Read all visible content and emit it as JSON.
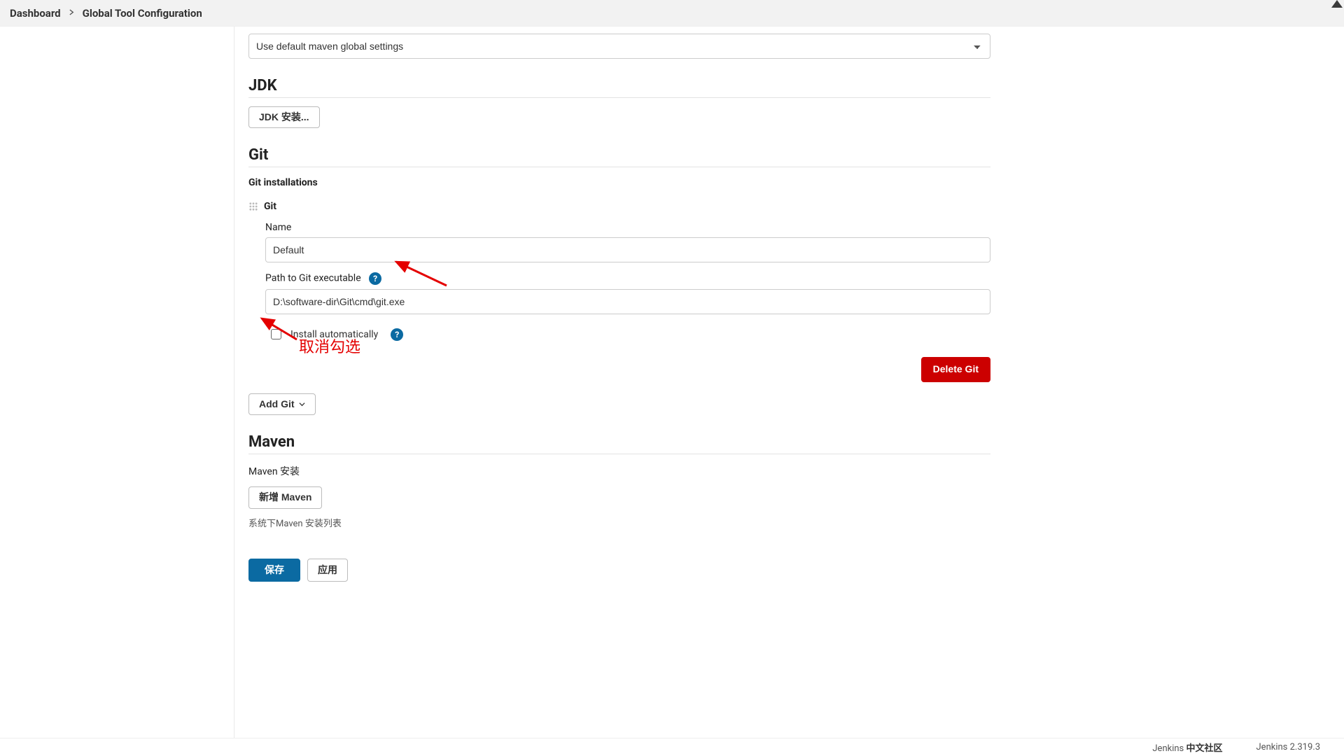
{
  "breadcrumb": {
    "dashboard": "Dashboard",
    "page": "Global Tool Configuration"
  },
  "maven_global_settings": {
    "selected": "Use default maven global settings"
  },
  "jdk": {
    "title": "JDK",
    "install_button": "JDK 安装..."
  },
  "git": {
    "title": "Git",
    "installations_label": "Git installations",
    "item_title": "Git",
    "name_label": "Name",
    "name_value": "Default",
    "path_label": "Path to Git executable",
    "path_value": "D:\\software-dir\\Git\\cmd\\git.exe",
    "install_auto_label": "Install automatically",
    "delete_button": "Delete Git",
    "add_button": "Add Git"
  },
  "maven": {
    "title": "Maven",
    "installs_label": "Maven 安装",
    "add_button": "新增 Maven",
    "hint": "系统下Maven 安装列表"
  },
  "actions": {
    "save": "保存",
    "apply": "应用"
  },
  "annotation": {
    "uncheck_text": "取消勾选"
  },
  "footer": {
    "left_prefix": "Jenkins ",
    "left_bold": "中文社区",
    "right": "Jenkins 2.319.3"
  }
}
